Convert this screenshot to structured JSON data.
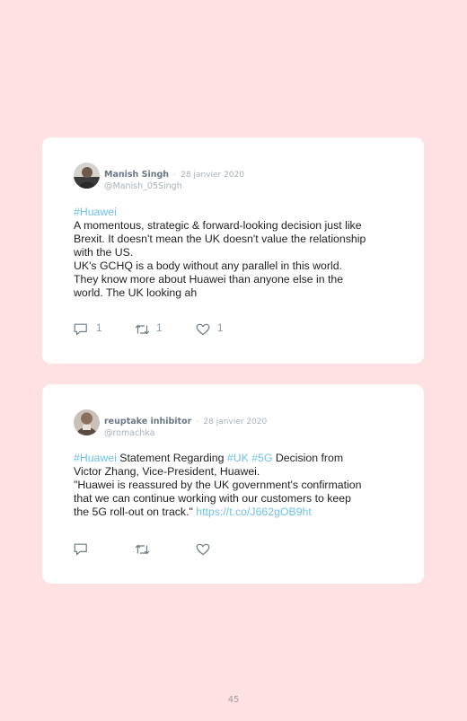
{
  "tweets": [
    {
      "author": "Manish Singh",
      "separator": "·",
      "date": "28 janvier 2020",
      "handle": "@Manish_05Singh",
      "lines": [
        [
          {
            "text": "#Huawei",
            "tag": true
          }
        ],
        [
          {
            "text": "A momentous, strategic & forward-looking decision just like",
            "tag": false
          }
        ],
        [
          {
            "text": "Brexit. It doesn't mean the UK doesn't value the relationship",
            "tag": false
          }
        ],
        [
          {
            "text": "with the US.",
            "tag": false
          }
        ],
        [
          {
            "text": "UK's GCHQ is a body without any parallel in this world.",
            "tag": false
          }
        ],
        [
          {
            "text": "They know more about Huawei than anyone else in the",
            "tag": false
          }
        ],
        [
          {
            "text": "world. The UK looking ah",
            "tag": false
          }
        ]
      ],
      "reply_count": "1",
      "retweet_count": "1",
      "like_count": "1"
    },
    {
      "author": "reuptake inhibitor",
      "separator": "·",
      "date": "28 janvier 2020",
      "handle": "@romachka",
      "lines": [
        [
          {
            "text": "#Huawei",
            "tag": true
          },
          {
            "text": " Statement Regarding ",
            "tag": false
          },
          {
            "text": "#UK",
            "tag": true
          },
          {
            "text": " ",
            "tag": false
          },
          {
            "text": "#5G",
            "tag": true
          },
          {
            "text": " Decision from",
            "tag": false
          }
        ],
        [
          {
            "text": "Victor Zhang, Vice-President, Huawei.",
            "tag": false
          }
        ],
        [
          {
            "text": "\"Huawei is reassured by the UK government's confirmation",
            "tag": false
          }
        ],
        [
          {
            "text": "that we can continue working with our customers to keep",
            "tag": false
          }
        ],
        [
          {
            "text": "the 5G roll-out on track.\" ",
            "tag": false
          },
          {
            "text": "https://t.co/J662gOB9ht",
            "tag": true
          }
        ]
      ],
      "reply_count": "",
      "retweet_count": "",
      "like_count": ""
    }
  ],
  "page_number": "45",
  "icons": {
    "reply": "reply-icon",
    "retweet": "retweet-icon",
    "like": "heart-icon"
  },
  "colors": {
    "background": "#ffe0e3",
    "card": "#ffffff",
    "hashtag": "#6fc1ea",
    "muted": "#a6b0ba",
    "author": "#6b7785",
    "icon": "#6e7a86"
  }
}
